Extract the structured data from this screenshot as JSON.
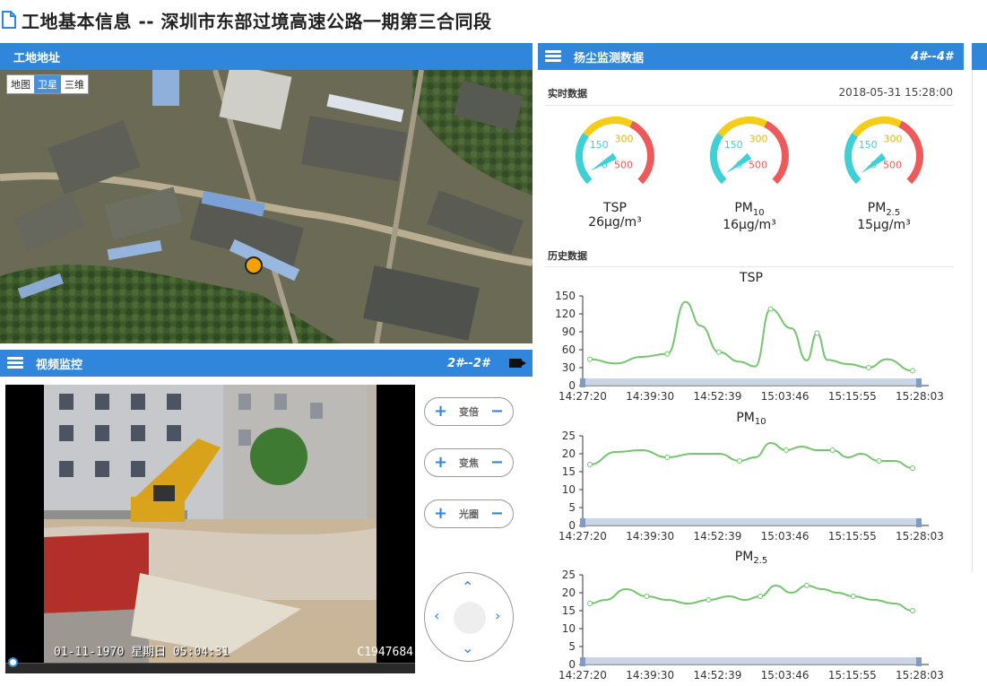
{
  "page": {
    "title": "工地基本信息 -- 深圳市东部过境高速公路一期第三合同段"
  },
  "map": {
    "header": "工地地址",
    "types": [
      "地图",
      "卫星",
      "三维"
    ],
    "active_type": "卫星"
  },
  "video": {
    "header": "视频监控",
    "channel": "2#--2#",
    "osd_time": "01-11-1970 星期日 05:04:31",
    "osd_id": "C1947684",
    "controls": [
      {
        "label": "变倍"
      },
      {
        "label": "变焦"
      },
      {
        "label": "光圈"
      }
    ]
  },
  "dust": {
    "header": "扬尘监测数据",
    "channel": "4#--4#",
    "realtime_label": "实时数据",
    "realtime_time": "2018-05-31 15:28:00",
    "history_label": "历史数据",
    "gauges": [
      {
        "name": "TSP",
        "sub": "",
        "value": "26μg/m³",
        "level": 26
      },
      {
        "name": "PM",
        "sub": "10",
        "value": "16μg/m³",
        "level": 16
      },
      {
        "name": "PM",
        "sub": "2.5",
        "value": "15μg/m³",
        "level": 15
      }
    ],
    "gauge_ticks": [
      "0",
      "150",
      "300",
      "500"
    ]
  },
  "chart_data": [
    {
      "type": "line",
      "title": "TSP",
      "x": [
        "14:27:20",
        "14:39:30",
        "14:52:39",
        "15:03:46",
        "15:15:55",
        "15:28:03"
      ],
      "series_points": [
        [
          0,
          44
        ],
        [
          0.1,
          37
        ],
        [
          0.2,
          48
        ],
        [
          0.3,
          53
        ],
        [
          0.37,
          140
        ],
        [
          0.43,
          100
        ],
        [
          0.5,
          56
        ],
        [
          0.58,
          40
        ],
        [
          0.64,
          32
        ],
        [
          0.7,
          128
        ],
        [
          0.78,
          96
        ],
        [
          0.84,
          42
        ],
        [
          0.88,
          88
        ],
        [
          0.92,
          43
        ],
        [
          1.0,
          36
        ],
        [
          1.08,
          30
        ],
        [
          1.15,
          44
        ],
        [
          1.25,
          25
        ]
      ],
      "ylim": [
        0,
        150
      ],
      "yticks": [
        0,
        30,
        60,
        90,
        120,
        150
      ],
      "color": "#74c66c"
    },
    {
      "type": "line",
      "title": "PM10",
      "title_main": "PM",
      "title_sub": "10",
      "x": [
        "14:27:20",
        "14:39:30",
        "14:52:39",
        "15:03:46",
        "15:15:55",
        "15:28:03"
      ],
      "series_points": [
        [
          0,
          17
        ],
        [
          0.1,
          20.5
        ],
        [
          0.2,
          21
        ],
        [
          0.3,
          19
        ],
        [
          0.4,
          20
        ],
        [
          0.5,
          20
        ],
        [
          0.58,
          18
        ],
        [
          0.64,
          19
        ],
        [
          0.7,
          23
        ],
        [
          0.76,
          21
        ],
        [
          0.82,
          22
        ],
        [
          0.88,
          21
        ],
        [
          0.94,
          21
        ],
        [
          1.0,
          19
        ],
        [
          1.05,
          20
        ],
        [
          1.12,
          18
        ],
        [
          1.18,
          18
        ],
        [
          1.25,
          16
        ]
      ],
      "ylim": [
        0,
        25
      ],
      "yticks": [
        0,
        5,
        10,
        15,
        20,
        25
      ],
      "color": "#74c66c"
    },
    {
      "type": "line",
      "title": "PM2.5",
      "title_main": "PM",
      "title_sub": "2.5",
      "x": [
        "14:27:20",
        "14:39:30",
        "14:52:39",
        "15:03:46",
        "15:15:55",
        "15:28:03"
      ],
      "series_points": [
        [
          0,
          17
        ],
        [
          0.06,
          18
        ],
        [
          0.14,
          21
        ],
        [
          0.22,
          19
        ],
        [
          0.3,
          18
        ],
        [
          0.38,
          17
        ],
        [
          0.46,
          18
        ],
        [
          0.54,
          19
        ],
        [
          0.6,
          18
        ],
        [
          0.66,
          19
        ],
        [
          0.72,
          22
        ],
        [
          0.78,
          20
        ],
        [
          0.84,
          22
        ],
        [
          0.9,
          21
        ],
        [
          0.96,
          20
        ],
        [
          1.02,
          19
        ],
        [
          1.1,
          18
        ],
        [
          1.18,
          17
        ],
        [
          1.25,
          15
        ]
      ],
      "ylim": [
        0,
        25
      ],
      "yticks": [
        0,
        5,
        10,
        15,
        20,
        25
      ],
      "color": "#74c66c"
    }
  ]
}
